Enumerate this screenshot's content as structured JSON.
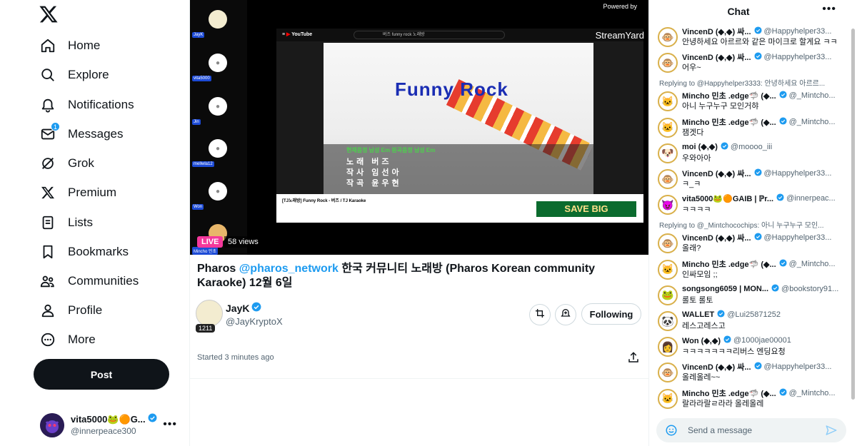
{
  "nav": {
    "items": [
      {
        "label": "Home",
        "icon": "home-icon"
      },
      {
        "label": "Explore",
        "icon": "search-icon"
      },
      {
        "label": "Notifications",
        "icon": "bell-icon"
      },
      {
        "label": "Messages",
        "icon": "mail-icon",
        "badge": "1"
      },
      {
        "label": "Grok",
        "icon": "grok-icon"
      },
      {
        "label": "Premium",
        "icon": "x-premium-icon"
      },
      {
        "label": "Lists",
        "icon": "list-icon"
      },
      {
        "label": "Bookmarks",
        "icon": "bookmark-icon"
      },
      {
        "label": "Communities",
        "icon": "communities-icon"
      },
      {
        "label": "Profile",
        "icon": "profile-icon"
      },
      {
        "label": "More",
        "icon": "more-circle-icon"
      }
    ],
    "post_label": "Post"
  },
  "account": {
    "name": "vita5000🐸🟠G...",
    "handle": "@innerpeace300"
  },
  "broadcast": {
    "powered_by": "Powered by",
    "streamyard": "StreamYard",
    "live_label": "LIVE",
    "views": "58 views",
    "title_prefix": "Pharos ",
    "title_mention": "@pharos_network",
    "title_rest": "  한국 커뮤니티 노래방 (Pharos Korean community Karaoke) 12월 6일",
    "host_name": "JayK",
    "host_handle": "@JayKryptoX",
    "host_count": "1211",
    "follow_label": "Following",
    "started": "Started 3 minutes ago"
  },
  "video": {
    "yt_search": "버즈 funny rock 노래방",
    "karaoke_title": "Funny Rock",
    "key_info": "현재음정 남성 Em   원곡음정 남성 Em",
    "lyric1": "노래  버즈",
    "lyric2": "작사  임선아",
    "lyric3": "작곡  윤우현",
    "yt_title": "[TJ노래방] Funny Rock - 버즈 / TJ Karaoke",
    "ad_text": "SAVE BIG",
    "side_labels": [
      "JayK",
      "vita5000",
      "Jin",
      "mellwla12",
      "Won",
      "Mincho 민초"
    ]
  },
  "chat": {
    "title": "Chat",
    "placeholder": "Send a message",
    "messages": [
      {
        "type": "msg",
        "name": "VincenD (◆,◆) 싸...",
        "handle": "@Happyhelper33...",
        "text": "안녕하세요 아르르와 같은 마이크로 할게요 ㅋㅋ",
        "avatar": "🐵"
      },
      {
        "type": "msg",
        "name": "VincenD (◆,◆) 싸...",
        "handle": "@Happyhelper33...",
        "text": "어우~",
        "avatar": "🐵"
      },
      {
        "type": "reply",
        "text": "Replying to @Happyhelper3333: 안녕하세요 아르르..."
      },
      {
        "type": "msg",
        "name": "Mincho 민초 .edge🦈 (◆...",
        "handle": "@_Mintcho...",
        "text": "아니 누구누구 모인거햐",
        "avatar": "🐱"
      },
      {
        "type": "msg",
        "name": "Mincho 민초 .edge🦈 (◆...",
        "handle": "@_Mintcho...",
        "text": "잼겟다",
        "avatar": "🐱"
      },
      {
        "type": "msg",
        "name": "moi (◆,◆)",
        "handle": "@moooo_iii",
        "text": "우와아아",
        "avatar": "🐶"
      },
      {
        "type": "msg",
        "name": "VincenD (◆,◆) 싸...",
        "handle": "@Happyhelper33...",
        "text": "ㅋ_ㅋ",
        "avatar": "🐵"
      },
      {
        "type": "msg",
        "name": "vita5000🐸🟠GAIB | ℙr...",
        "handle": "@innerpeac...",
        "text": "ㅋㅋㅋㅋ",
        "avatar": "😈"
      },
      {
        "type": "reply",
        "text": "Replying to @_Mintchocochips: 아니 누구누구 모인..."
      },
      {
        "type": "msg",
        "name": "VincenD (◆,◆) 싸...",
        "handle": "@Happyhelper33...",
        "text": "올래?",
        "avatar": "🐵"
      },
      {
        "type": "msg",
        "name": "Mincho 민초 .edge🦈 (◆...",
        "handle": "@_Mintcho...",
        "text": "인싸모임 ;;",
        "avatar": "🐱"
      },
      {
        "type": "msg",
        "name": "songsong6059 | MON...",
        "handle": "@bookstory91...",
        "text": "롤토 롤토",
        "avatar": "🐸"
      },
      {
        "type": "msg",
        "name": "WALLET",
        "handle": "@Lui25871252",
        "text": "레스고레스고",
        "avatar": "🐼"
      },
      {
        "type": "msg",
        "name": "Won (◆,◆)",
        "handle": "@1000jae00001",
        "text": "ㅋㅋㅋㅋㅋㅋㅋ리버스 엔딩요청",
        "avatar": "👩"
      },
      {
        "type": "msg",
        "name": "VincenD (◆,◆) 싸...",
        "handle": "@Happyhelper33...",
        "text": "올레올레~~",
        "avatar": "🐵"
      },
      {
        "type": "msg",
        "name": "Mincho 민초 .edge🦈 (◆...",
        "handle": "@_Mintcho...",
        "text": "랄라라랄ㄹ라라 올레올레",
        "avatar": "🐱"
      }
    ]
  }
}
